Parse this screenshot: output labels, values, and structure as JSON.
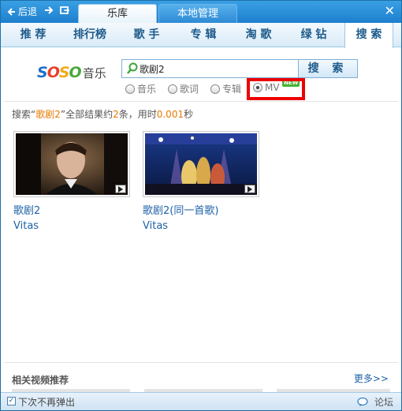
{
  "titlebar": {
    "back_label": "后退",
    "tabs": [
      {
        "label": "乐库",
        "active": true
      },
      {
        "label": "本地管理",
        "active": false
      }
    ],
    "close_label": "✕"
  },
  "categories": [
    {
      "label": "推 荐"
    },
    {
      "label": "排行榜"
    },
    {
      "label": "歌 手"
    },
    {
      "label": "专 辑"
    },
    {
      "label": "淘 歌"
    },
    {
      "label": "绿 钻"
    },
    {
      "label": "搜 索",
      "active": true
    }
  ],
  "search": {
    "logo_text": "SOSO",
    "logo_suffix": "音乐",
    "query": "歌剧2",
    "button_label": "搜 索",
    "options": [
      {
        "label": "音乐",
        "checked": false
      },
      {
        "label": "歌词",
        "checked": false
      },
      {
        "label": "专辑",
        "checked": false
      },
      {
        "label": "MV",
        "checked": true
      }
    ],
    "new_badge": "NEW"
  },
  "summary": {
    "prefix": "搜索“",
    "keyword": "歌剧2",
    "middle": "”全部结果约",
    "count": "2",
    "after_count": "条，用时",
    "time": "0.001",
    "suffix": "秒"
  },
  "results": [
    {
      "title": "歌剧2",
      "artist": "Vitas"
    },
    {
      "title": "歌剧2(同一首歌)",
      "artist": "Vitas"
    }
  ],
  "related": {
    "title": "相关视频推荐",
    "more_label": "更多>>"
  },
  "statusbar": {
    "checkbox_label": "下次不再弹出",
    "forum_label": "论坛"
  },
  "colors": {
    "accent_blue": "#1e7fcd",
    "link": "#1e62a8",
    "highlight": "#ee0000",
    "new_badge": "#4cb232"
  }
}
